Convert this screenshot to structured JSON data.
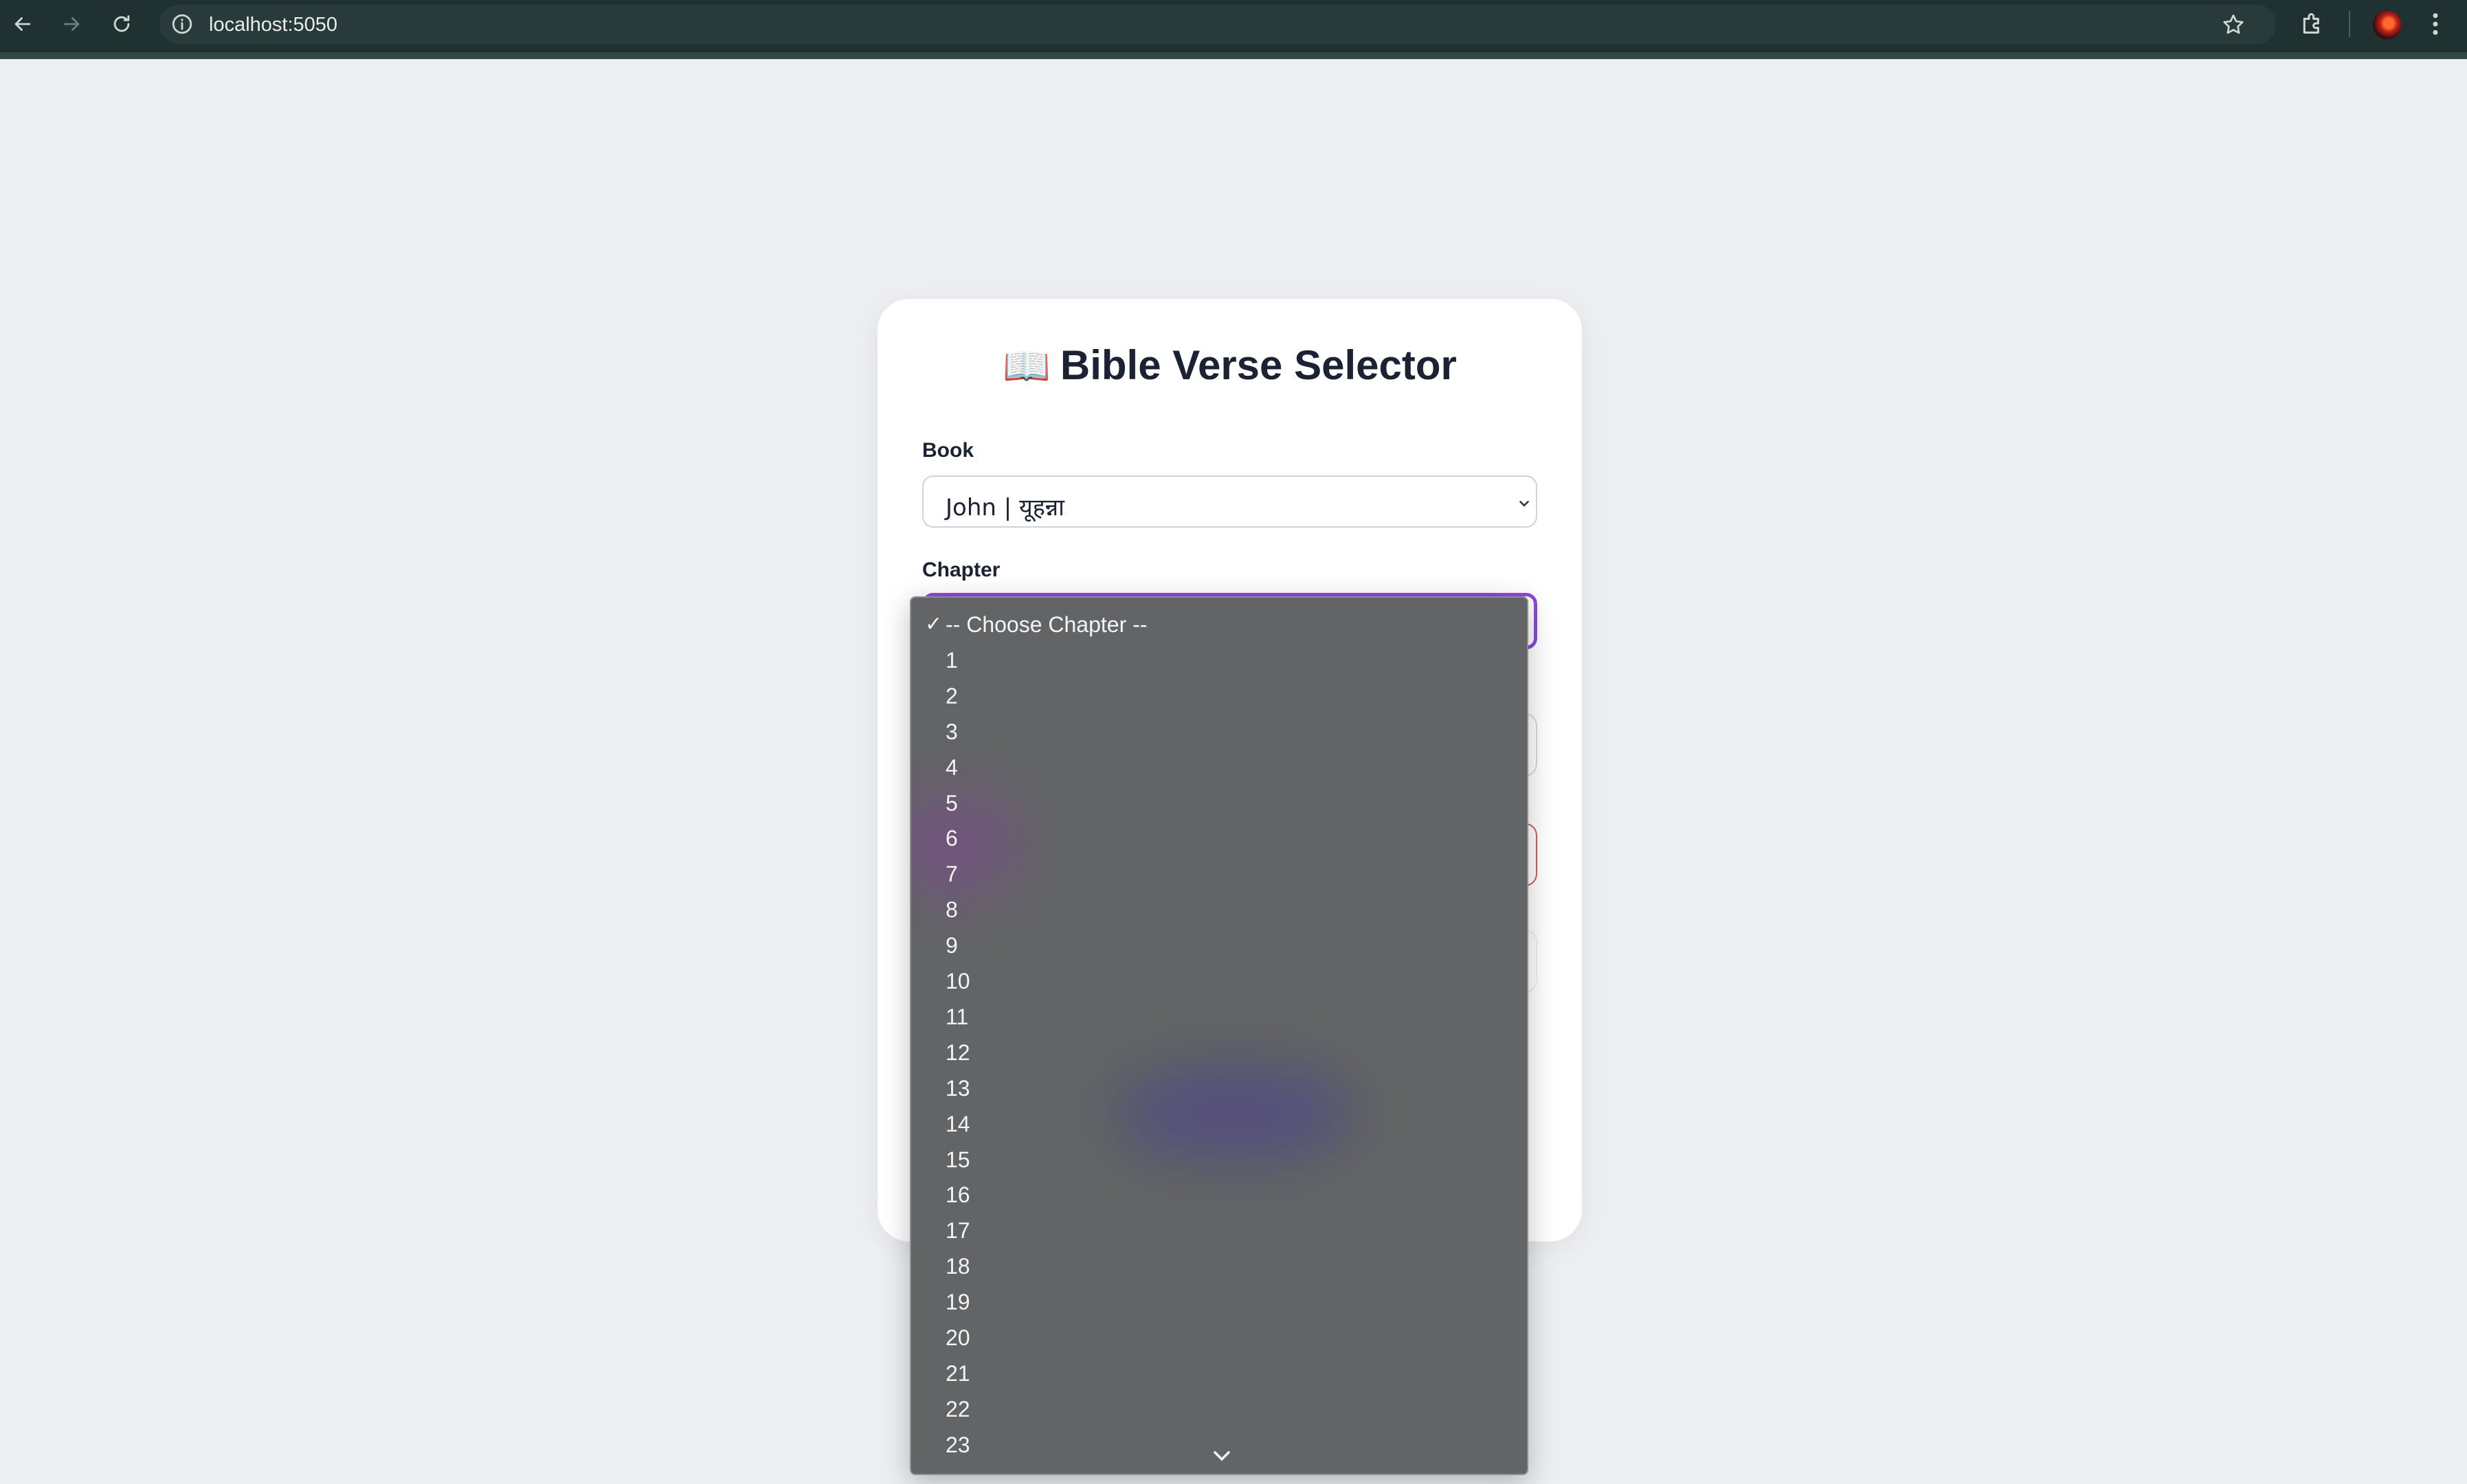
{
  "browser": {
    "url": "localhost:5050",
    "icons": [
      "back-arrow-icon",
      "forward-arrow-icon",
      "reload-icon",
      "info-icon",
      "star-icon",
      "extensions-icon",
      "avatar",
      "kebab-menu-icon"
    ]
  },
  "card": {
    "title_icon": "📖",
    "title": "Bible Verse Selector",
    "book": {
      "label": "Book",
      "value": "John | यूहन्ना"
    },
    "chapter": {
      "label": "Chapter",
      "selected": "-- Choose Chapter --"
    }
  },
  "dropdown": {
    "check_mark": "✓",
    "options": [
      "-- Choose Chapter --",
      "1",
      "2",
      "3",
      "4",
      "5",
      "6",
      "7",
      "8",
      "9",
      "10",
      "11",
      "12",
      "13",
      "14",
      "15",
      "16",
      "17",
      "18",
      "19",
      "20",
      "21",
      "22",
      "23"
    ]
  },
  "colors": {
    "chrome_bg": "#1f3130",
    "focus_border": "#8a4bd8",
    "error_border": "#e05555",
    "dropdown_bg": "#626465"
  }
}
